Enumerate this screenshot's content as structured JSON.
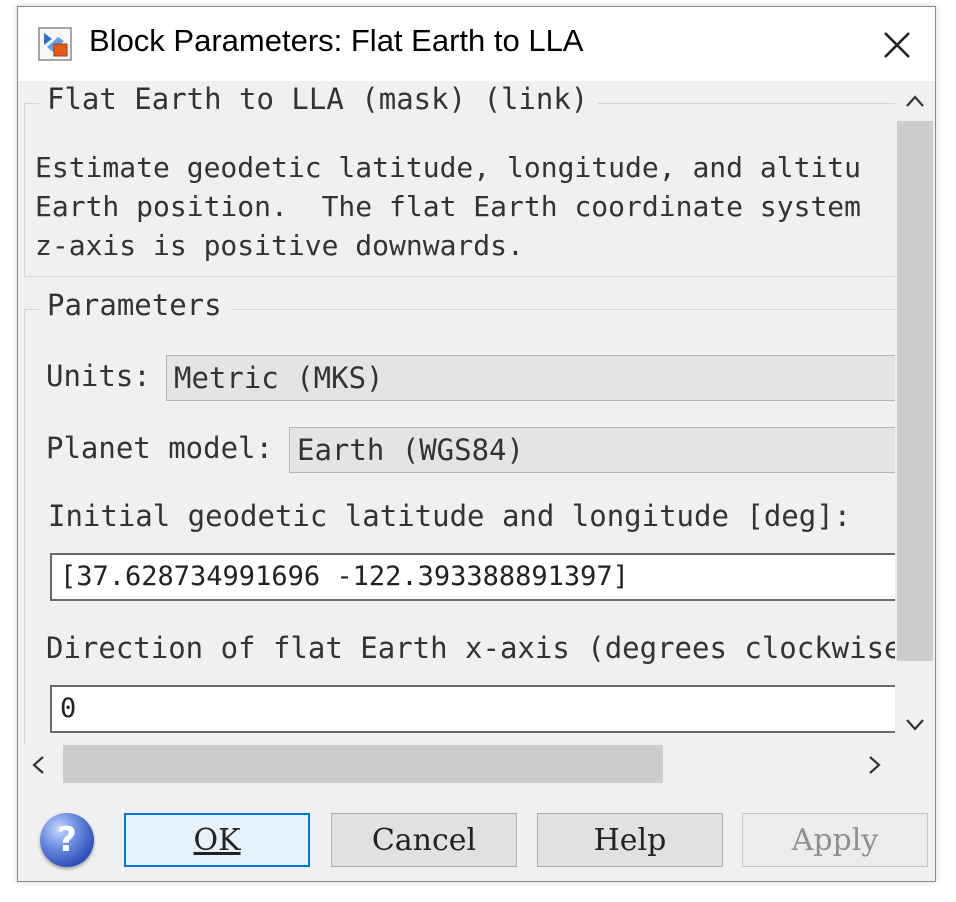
{
  "window": {
    "title": "Block Parameters: Flat Earth to LLA"
  },
  "mask_group": {
    "legend": "Flat Earth to LLA (mask) (link)",
    "description": "Estimate geodetic latitude, longitude, and altitu\nEarth position.  The flat Earth coordinate system\nz-axis is positive downwards."
  },
  "params_group": {
    "legend": "Parameters",
    "units_label": "Units:",
    "units_value": "Metric (MKS)",
    "planet_label": "Planet model:",
    "planet_value": "Earth (WGS84)",
    "latlon_label": "Initial geodetic latitude and longitude [deg]:",
    "latlon_value": "[37.628734991696 -122.393388891397]",
    "direction_label": "Direction of flat Earth x-axis (degrees clockwise",
    "direction_value": "0"
  },
  "buttons": {
    "ok": "OK",
    "cancel": "Cancel",
    "help": "Help",
    "apply": "Apply"
  },
  "icons": {
    "app_icon": "simulink-block-icon",
    "close": "close-icon",
    "help": "help-question-icon"
  },
  "colors": {
    "default_button_border": "#0078d7",
    "help_icon": "#2d4fb8"
  }
}
